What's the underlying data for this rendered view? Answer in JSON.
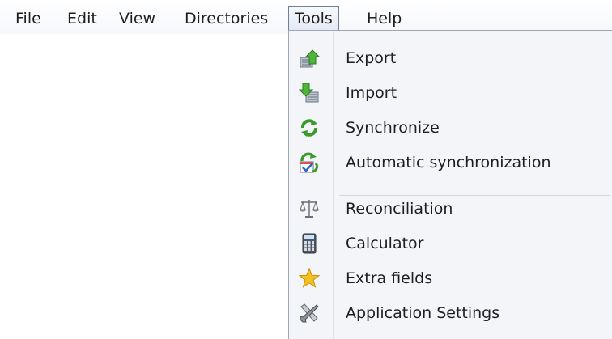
{
  "menubar": {
    "items": [
      {
        "label": "File"
      },
      {
        "label": "Edit"
      },
      {
        "label": "View"
      },
      {
        "label": "Directories"
      },
      {
        "label": "Tools",
        "active": true
      },
      {
        "label": "Help"
      }
    ]
  },
  "tools_menu": {
    "items": [
      {
        "label": "Export",
        "icon": "export-icon"
      },
      {
        "label": "Import",
        "icon": "import-icon"
      },
      {
        "label": "Synchronize",
        "icon": "synchronize-icon"
      },
      {
        "label": "Automatic synchronization",
        "icon": "automatic-synchronization-icon"
      },
      {
        "label": "Reconciliation",
        "icon": "scales-icon"
      },
      {
        "label": "Calculator",
        "icon": "calculator-icon"
      },
      {
        "label": "Extra fields",
        "icon": "star-icon"
      },
      {
        "label": "Application Settings",
        "icon": "tools-icon"
      }
    ]
  },
  "colors": {
    "accent_green": "#3a9a2a",
    "star_yellow": "#f3c021",
    "menu_background": "#f4f5f8"
  }
}
